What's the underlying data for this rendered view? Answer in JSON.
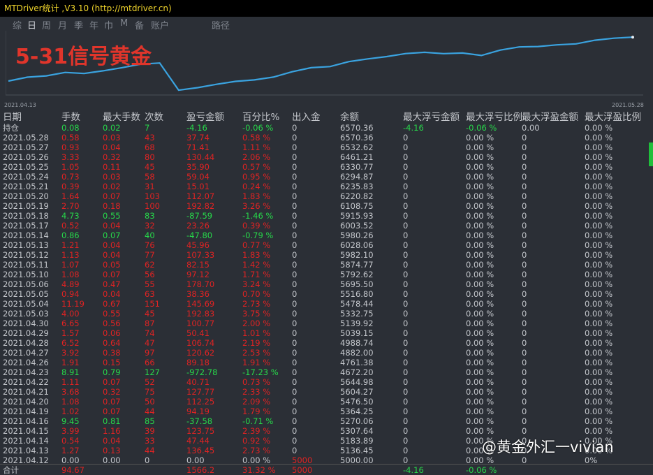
{
  "window": {
    "title": "MTDriver统计 ,V3.10 (http://mtdriver.cn)"
  },
  "tabs": [
    "综",
    "日",
    "周",
    "月",
    "季",
    "年",
    "巾",
    "M",
    "备",
    "账户",
    "路径"
  ],
  "chart": {
    "overlay_title": "5-31信号黄金",
    "start_date": "2021.04.13",
    "end_date": "2021.05.28",
    "line_color": "#3aa3e0"
  },
  "chart_data": {
    "type": "line",
    "x": [
      "2021.04.12",
      "2021.04.13",
      "2021.04.14",
      "2021.04.15",
      "2021.04.16",
      "2021.04.19",
      "2021.04.20",
      "2021.04.21",
      "2021.04.22",
      "2021.04.23",
      "2021.04.26",
      "2021.04.27",
      "2021.04.28",
      "2021.04.29",
      "2021.04.30",
      "2021.05.03",
      "2021.05.04",
      "2021.05.05",
      "2021.05.06",
      "2021.05.10",
      "2021.05.11",
      "2021.05.12",
      "2021.05.13",
      "2021.05.14",
      "2021.05.17",
      "2021.05.18",
      "2021.05.19",
      "2021.05.20",
      "2021.05.21",
      "2021.05.24",
      "2021.05.25",
      "2021.05.26",
      "2021.05.27",
      "2021.05.28"
    ],
    "series": [
      {
        "values": [
          5000.0,
          5136.45,
          5183.89,
          5307.64,
          5270.06,
          5364.25,
          5476.5,
          5604.27,
          5644.98,
          4672.2,
          4761.38,
          4882.0,
          4988.74,
          5039.15,
          5139.92,
          5332.75,
          5478.44,
          5516.8,
          5695.5,
          5792.62,
          5874.77,
          5982.1,
          6028.06,
          5980.26,
          6003.52,
          5915.93,
          6108.75,
          6220.82,
          6235.83,
          6294.87,
          6330.77,
          6461.21,
          6532.62,
          6570.36
        ]
      }
    ],
    "xlabel": "",
    "ylabel": "",
    "grid": false
  },
  "table": {
    "headers": [
      "日期",
      "手数",
      "最大手数",
      "次数",
      "盈亏金额",
      "百分比%",
      "出入金",
      "余额",
      "最大浮亏金额",
      "最大浮亏比例",
      "最大浮盈金额",
      "最大浮盈比例"
    ],
    "rows": [
      {
        "c": [
          "持仓",
          "0.08",
          "0.02",
          "7",
          "-4.16",
          "-0.06 %",
          "0",
          "6570.36",
          "-4.16",
          "-0.06 %",
          "0.00",
          "0.00 %"
        ],
        "k": [
          "w",
          "g",
          "g",
          "g",
          "g",
          "g",
          "w",
          "w",
          "g",
          "g",
          "w",
          "w"
        ]
      },
      {
        "c": [
          "2021.05.28",
          "0.58",
          "0.03",
          "43",
          "37.74",
          "0.58 %",
          "0",
          "6570.36",
          "0",
          "0.00 %",
          "0",
          "0.00 %"
        ],
        "k": [
          "w",
          "r",
          "r",
          "r",
          "r",
          "r",
          "w",
          "w",
          "w",
          "w",
          "w",
          "w"
        ]
      },
      {
        "c": [
          "2021.05.27",
          "0.93",
          "0.04",
          "68",
          "71.41",
          "1.11 %",
          "0",
          "6532.62",
          "0",
          "0.00 %",
          "0",
          "0.00 %"
        ],
        "k": [
          "w",
          "r",
          "r",
          "r",
          "r",
          "r",
          "w",
          "w",
          "w",
          "w",
          "w",
          "w"
        ]
      },
      {
        "c": [
          "2021.05.26",
          "3.33",
          "0.32",
          "80",
          "130.44",
          "2.06 %",
          "0",
          "6461.21",
          "0",
          "0.00 %",
          "0",
          "0.00 %"
        ],
        "k": [
          "w",
          "r",
          "r",
          "r",
          "r",
          "r",
          "w",
          "w",
          "w",
          "w",
          "w",
          "w"
        ]
      },
      {
        "c": [
          "2021.05.25",
          "1.05",
          "0.11",
          "45",
          "35.90",
          "0.57 %",
          "0",
          "6330.77",
          "0",
          "0.00 %",
          "0",
          "0.00 %"
        ],
        "k": [
          "w",
          "r",
          "r",
          "r",
          "r",
          "r",
          "w",
          "w",
          "w",
          "w",
          "w",
          "w"
        ]
      },
      {
        "c": [
          "2021.05.24",
          "0.73",
          "0.03",
          "58",
          "59.04",
          "0.95 %",
          "0",
          "6294.87",
          "0",
          "0.00 %",
          "0",
          "0.00 %"
        ],
        "k": [
          "w",
          "r",
          "r",
          "r",
          "r",
          "r",
          "w",
          "w",
          "w",
          "w",
          "w",
          "w"
        ]
      },
      {
        "c": [
          "2021.05.21",
          "0.39",
          "0.02",
          "31",
          "15.01",
          "0.24 %",
          "0",
          "6235.83",
          "0",
          "0.00 %",
          "0",
          "0.00 %"
        ],
        "k": [
          "w",
          "r",
          "r",
          "r",
          "r",
          "r",
          "w",
          "w",
          "w",
          "w",
          "w",
          "w"
        ]
      },
      {
        "c": [
          "2021.05.20",
          "1.64",
          "0.07",
          "103",
          "112.07",
          "1.83 %",
          "0",
          "6220.82",
          "0",
          "0.00 %",
          "0",
          "0.00 %"
        ],
        "k": [
          "w",
          "r",
          "r",
          "r",
          "r",
          "r",
          "w",
          "w",
          "w",
          "w",
          "w",
          "w"
        ]
      },
      {
        "c": [
          "2021.05.19",
          "2.70",
          "0.18",
          "100",
          "192.82",
          "3.26 %",
          "0",
          "6108.75",
          "0",
          "0.00 %",
          "0",
          "0.00 %"
        ],
        "k": [
          "w",
          "r",
          "r",
          "r",
          "r",
          "r",
          "w",
          "w",
          "w",
          "w",
          "w",
          "w"
        ]
      },
      {
        "c": [
          "2021.05.18",
          "4.73",
          "0.55",
          "83",
          "-87.59",
          "-1.46 %",
          "0",
          "5915.93",
          "0",
          "0.00 %",
          "0",
          "0.00 %"
        ],
        "k": [
          "w",
          "g",
          "g",
          "g",
          "g",
          "g",
          "w",
          "w",
          "w",
          "w",
          "w",
          "w"
        ]
      },
      {
        "c": [
          "2021.05.17",
          "0.52",
          "0.04",
          "32",
          "23.26",
          "0.39 %",
          "0",
          "6003.52",
          "0",
          "0.00 %",
          "0",
          "0.00 %"
        ],
        "k": [
          "w",
          "r",
          "r",
          "r",
          "r",
          "r",
          "w",
          "w",
          "w",
          "w",
          "w",
          "w"
        ]
      },
      {
        "c": [
          "2021.05.14",
          "0.86",
          "0.07",
          "40",
          "-47.80",
          "-0.79 %",
          "0",
          "5980.26",
          "0",
          "0.00 %",
          "0",
          "0.00 %"
        ],
        "k": [
          "w",
          "g",
          "g",
          "g",
          "g",
          "g",
          "w",
          "w",
          "w",
          "w",
          "w",
          "w"
        ]
      },
      {
        "c": [
          "2021.05.13",
          "1.21",
          "0.04",
          "76",
          "45.96",
          "0.77 %",
          "0",
          "6028.06",
          "0",
          "0.00 %",
          "0",
          "0.00 %"
        ],
        "k": [
          "w",
          "r",
          "r",
          "r",
          "r",
          "r",
          "w",
          "w",
          "w",
          "w",
          "w",
          "w"
        ]
      },
      {
        "c": [
          "2021.05.12",
          "1.13",
          "0.04",
          "77",
          "107.33",
          "1.83 %",
          "0",
          "5982.10",
          "0",
          "0.00 %",
          "0",
          "0.00 %"
        ],
        "k": [
          "w",
          "r",
          "r",
          "r",
          "r",
          "r",
          "w",
          "w",
          "w",
          "w",
          "w",
          "w"
        ]
      },
      {
        "c": [
          "2021.05.11",
          "1.07",
          "0.05",
          "62",
          "82.15",
          "1.42 %",
          "0",
          "5874.77",
          "0",
          "0.00 %",
          "0",
          "0.00 %"
        ],
        "k": [
          "w",
          "r",
          "r",
          "r",
          "r",
          "r",
          "w",
          "w",
          "w",
          "w",
          "w",
          "w"
        ]
      },
      {
        "c": [
          "2021.05.10",
          "1.08",
          "0.07",
          "56",
          "97.12",
          "1.71 %",
          "0",
          "5792.62",
          "0",
          "0.00 %",
          "0",
          "0.00 %"
        ],
        "k": [
          "w",
          "r",
          "r",
          "r",
          "r",
          "r",
          "w",
          "w",
          "w",
          "w",
          "w",
          "w"
        ]
      },
      {
        "c": [
          "2021.05.06",
          "4.89",
          "0.47",
          "55",
          "178.70",
          "3.24 %",
          "0",
          "5695.50",
          "0",
          "0.00 %",
          "0",
          "0.00 %"
        ],
        "k": [
          "w",
          "r",
          "r",
          "r",
          "r",
          "r",
          "w",
          "w",
          "w",
          "w",
          "w",
          "w"
        ]
      },
      {
        "c": [
          "2021.05.05",
          "0.94",
          "0.04",
          "63",
          "38.36",
          "0.70 %",
          "0",
          "5516.80",
          "0",
          "0.00 %",
          "0",
          "0.00 %"
        ],
        "k": [
          "w",
          "r",
          "r",
          "r",
          "r",
          "r",
          "w",
          "w",
          "w",
          "w",
          "w",
          "w"
        ]
      },
      {
        "c": [
          "2021.05.04",
          "11.19",
          "0.67",
          "151",
          "145.69",
          "2.73 %",
          "0",
          "5478.44",
          "0",
          "0.00 %",
          "0",
          "0.00 %"
        ],
        "k": [
          "w",
          "r",
          "r",
          "r",
          "r",
          "r",
          "w",
          "w",
          "w",
          "w",
          "w",
          "w"
        ]
      },
      {
        "c": [
          "2021.05.03",
          "4.00",
          "0.55",
          "45",
          "192.83",
          "3.75 %",
          "0",
          "5332.75",
          "0",
          "0.00 %",
          "0",
          "0.00 %"
        ],
        "k": [
          "w",
          "r",
          "r",
          "r",
          "r",
          "r",
          "w",
          "w",
          "w",
          "w",
          "w",
          "w"
        ]
      },
      {
        "c": [
          "2021.04.30",
          "6.65",
          "0.56",
          "87",
          "100.77",
          "2.00 %",
          "0",
          "5139.92",
          "0",
          "0.00 %",
          "0",
          "0.00 %"
        ],
        "k": [
          "w",
          "r",
          "r",
          "r",
          "r",
          "r",
          "w",
          "w",
          "w",
          "w",
          "w",
          "w"
        ]
      },
      {
        "c": [
          "2021.04.29",
          "1.57",
          "0.06",
          "74",
          "50.41",
          "1.01 %",
          "0",
          "5039.15",
          "0",
          "0.00 %",
          "0",
          "0.00 %"
        ],
        "k": [
          "w",
          "r",
          "r",
          "r",
          "r",
          "r",
          "w",
          "w",
          "w",
          "w",
          "w",
          "w"
        ]
      },
      {
        "c": [
          "2021.04.28",
          "6.52",
          "0.64",
          "47",
          "106.74",
          "2.19 %",
          "0",
          "4988.74",
          "0",
          "0.00 %",
          "0",
          "0.00 %"
        ],
        "k": [
          "w",
          "r",
          "r",
          "r",
          "r",
          "r",
          "w",
          "w",
          "w",
          "w",
          "w",
          "w"
        ]
      },
      {
        "c": [
          "2021.04.27",
          "3.92",
          "0.38",
          "97",
          "120.62",
          "2.53 %",
          "0",
          "4882.00",
          "0",
          "0.00 %",
          "0",
          "0.00 %"
        ],
        "k": [
          "w",
          "r",
          "r",
          "r",
          "r",
          "r",
          "w",
          "w",
          "w",
          "w",
          "w",
          "w"
        ]
      },
      {
        "c": [
          "2021.04.26",
          "1.91",
          "0.15",
          "66",
          "89.18",
          "1.91 %",
          "0",
          "4761.38",
          "0",
          "0.00 %",
          "0",
          "0.00 %"
        ],
        "k": [
          "w",
          "r",
          "r",
          "r",
          "r",
          "r",
          "w",
          "w",
          "w",
          "w",
          "w",
          "w"
        ]
      },
      {
        "c": [
          "2021.04.23",
          "8.91",
          "0.79",
          "127",
          "-972.78",
          "-17.23 %",
          "0",
          "4672.20",
          "0",
          "0.00 %",
          "0",
          "0.00 %"
        ],
        "k": [
          "w",
          "g",
          "g",
          "g",
          "g",
          "g",
          "w",
          "w",
          "w",
          "w",
          "w",
          "w"
        ]
      },
      {
        "c": [
          "2021.04.22",
          "1.11",
          "0.07",
          "52",
          "40.71",
          "0.73 %",
          "0",
          "5644.98",
          "0",
          "0.00 %",
          "0",
          "0.00 %"
        ],
        "k": [
          "w",
          "r",
          "r",
          "r",
          "r",
          "r",
          "w",
          "w",
          "w",
          "w",
          "w",
          "w"
        ]
      },
      {
        "c": [
          "2021.04.21",
          "3.68",
          "0.32",
          "75",
          "127.77",
          "2.33 %",
          "0",
          "5604.27",
          "0",
          "0.00 %",
          "0",
          "0.00 %"
        ],
        "k": [
          "w",
          "r",
          "r",
          "r",
          "r",
          "r",
          "w",
          "w",
          "w",
          "w",
          "w",
          "w"
        ]
      },
      {
        "c": [
          "2021.04.20",
          "1.08",
          "0.07",
          "50",
          "112.25",
          "2.09 %",
          "0",
          "5476.50",
          "0",
          "0.00 %",
          "0",
          "0.00 %"
        ],
        "k": [
          "w",
          "r",
          "r",
          "r",
          "r",
          "r",
          "w",
          "w",
          "w",
          "w",
          "w",
          "w"
        ]
      },
      {
        "c": [
          "2021.04.19",
          "1.02",
          "0.07",
          "44",
          "94.19",
          "1.79 %",
          "0",
          "5364.25",
          "0",
          "0.00 %",
          "0",
          "0.00 %"
        ],
        "k": [
          "w",
          "r",
          "r",
          "r",
          "r",
          "r",
          "w",
          "w",
          "w",
          "w",
          "w",
          "w"
        ]
      },
      {
        "c": [
          "2021.04.16",
          "9.45",
          "0.81",
          "85",
          "-37.58",
          "-0.71 %",
          "0",
          "5270.06",
          "0",
          "0.00 %",
          "0",
          "0.00 %"
        ],
        "k": [
          "w",
          "g",
          "g",
          "g",
          "g",
          "g",
          "w",
          "w",
          "w",
          "w",
          "w",
          "w"
        ]
      },
      {
        "c": [
          "2021.04.15",
          "3.99",
          "1.16",
          "39",
          "123.75",
          "2.39 %",
          "0",
          "5307.64",
          "0",
          "0.00 %",
          "0",
          "0.00 %"
        ],
        "k": [
          "w",
          "r",
          "r",
          "r",
          "r",
          "r",
          "w",
          "w",
          "w",
          "w",
          "w",
          "w"
        ]
      },
      {
        "c": [
          "2021.04.14",
          "0.54",
          "0.04",
          "33",
          "47.44",
          "0.92 %",
          "0",
          "5183.89",
          "0",
          "0.00 %",
          "0",
          "0.00 %"
        ],
        "k": [
          "w",
          "r",
          "r",
          "r",
          "r",
          "r",
          "w",
          "w",
          "w",
          "w",
          "w",
          "w"
        ]
      },
      {
        "c": [
          "2021.04.13",
          "1.27",
          "0.13",
          "44",
          "136.45",
          "2.73 %",
          "0",
          "5136.45",
          "0",
          "0.00 %",
          "0",
          "0.00 %"
        ],
        "k": [
          "w",
          "r",
          "r",
          "r",
          "r",
          "r",
          "w",
          "w",
          "w",
          "w",
          "w",
          "w"
        ]
      },
      {
        "c": [
          "2021.04.12",
          "0.00",
          "0.00",
          "0",
          "0.00",
          "0.00 %",
          "5000",
          "5000.00",
          "0",
          "0.00 %",
          "0",
          "0%"
        ],
        "k": [
          "w",
          "w",
          "w",
          "w",
          "w",
          "w",
          "r",
          "w",
          "w",
          "w",
          "w",
          "w"
        ]
      },
      {
        "c": [
          "合计",
          "94.67",
          "",
          "",
          "1566.2",
          "31.32 %",
          "5000",
          "",
          "-4.16",
          "-0.06 %",
          "",
          ""
        ],
        "k": [
          "w",
          "r",
          "w",
          "w",
          "r",
          "r",
          "r",
          "w",
          "g",
          "g",
          "w",
          "w"
        ]
      }
    ]
  },
  "watermark": "@黄金外汇一vivian",
  "colors": {
    "profit": "#e02323",
    "loss": "#27d84a",
    "title": "#f0d52c",
    "background": "#2b2f36"
  }
}
